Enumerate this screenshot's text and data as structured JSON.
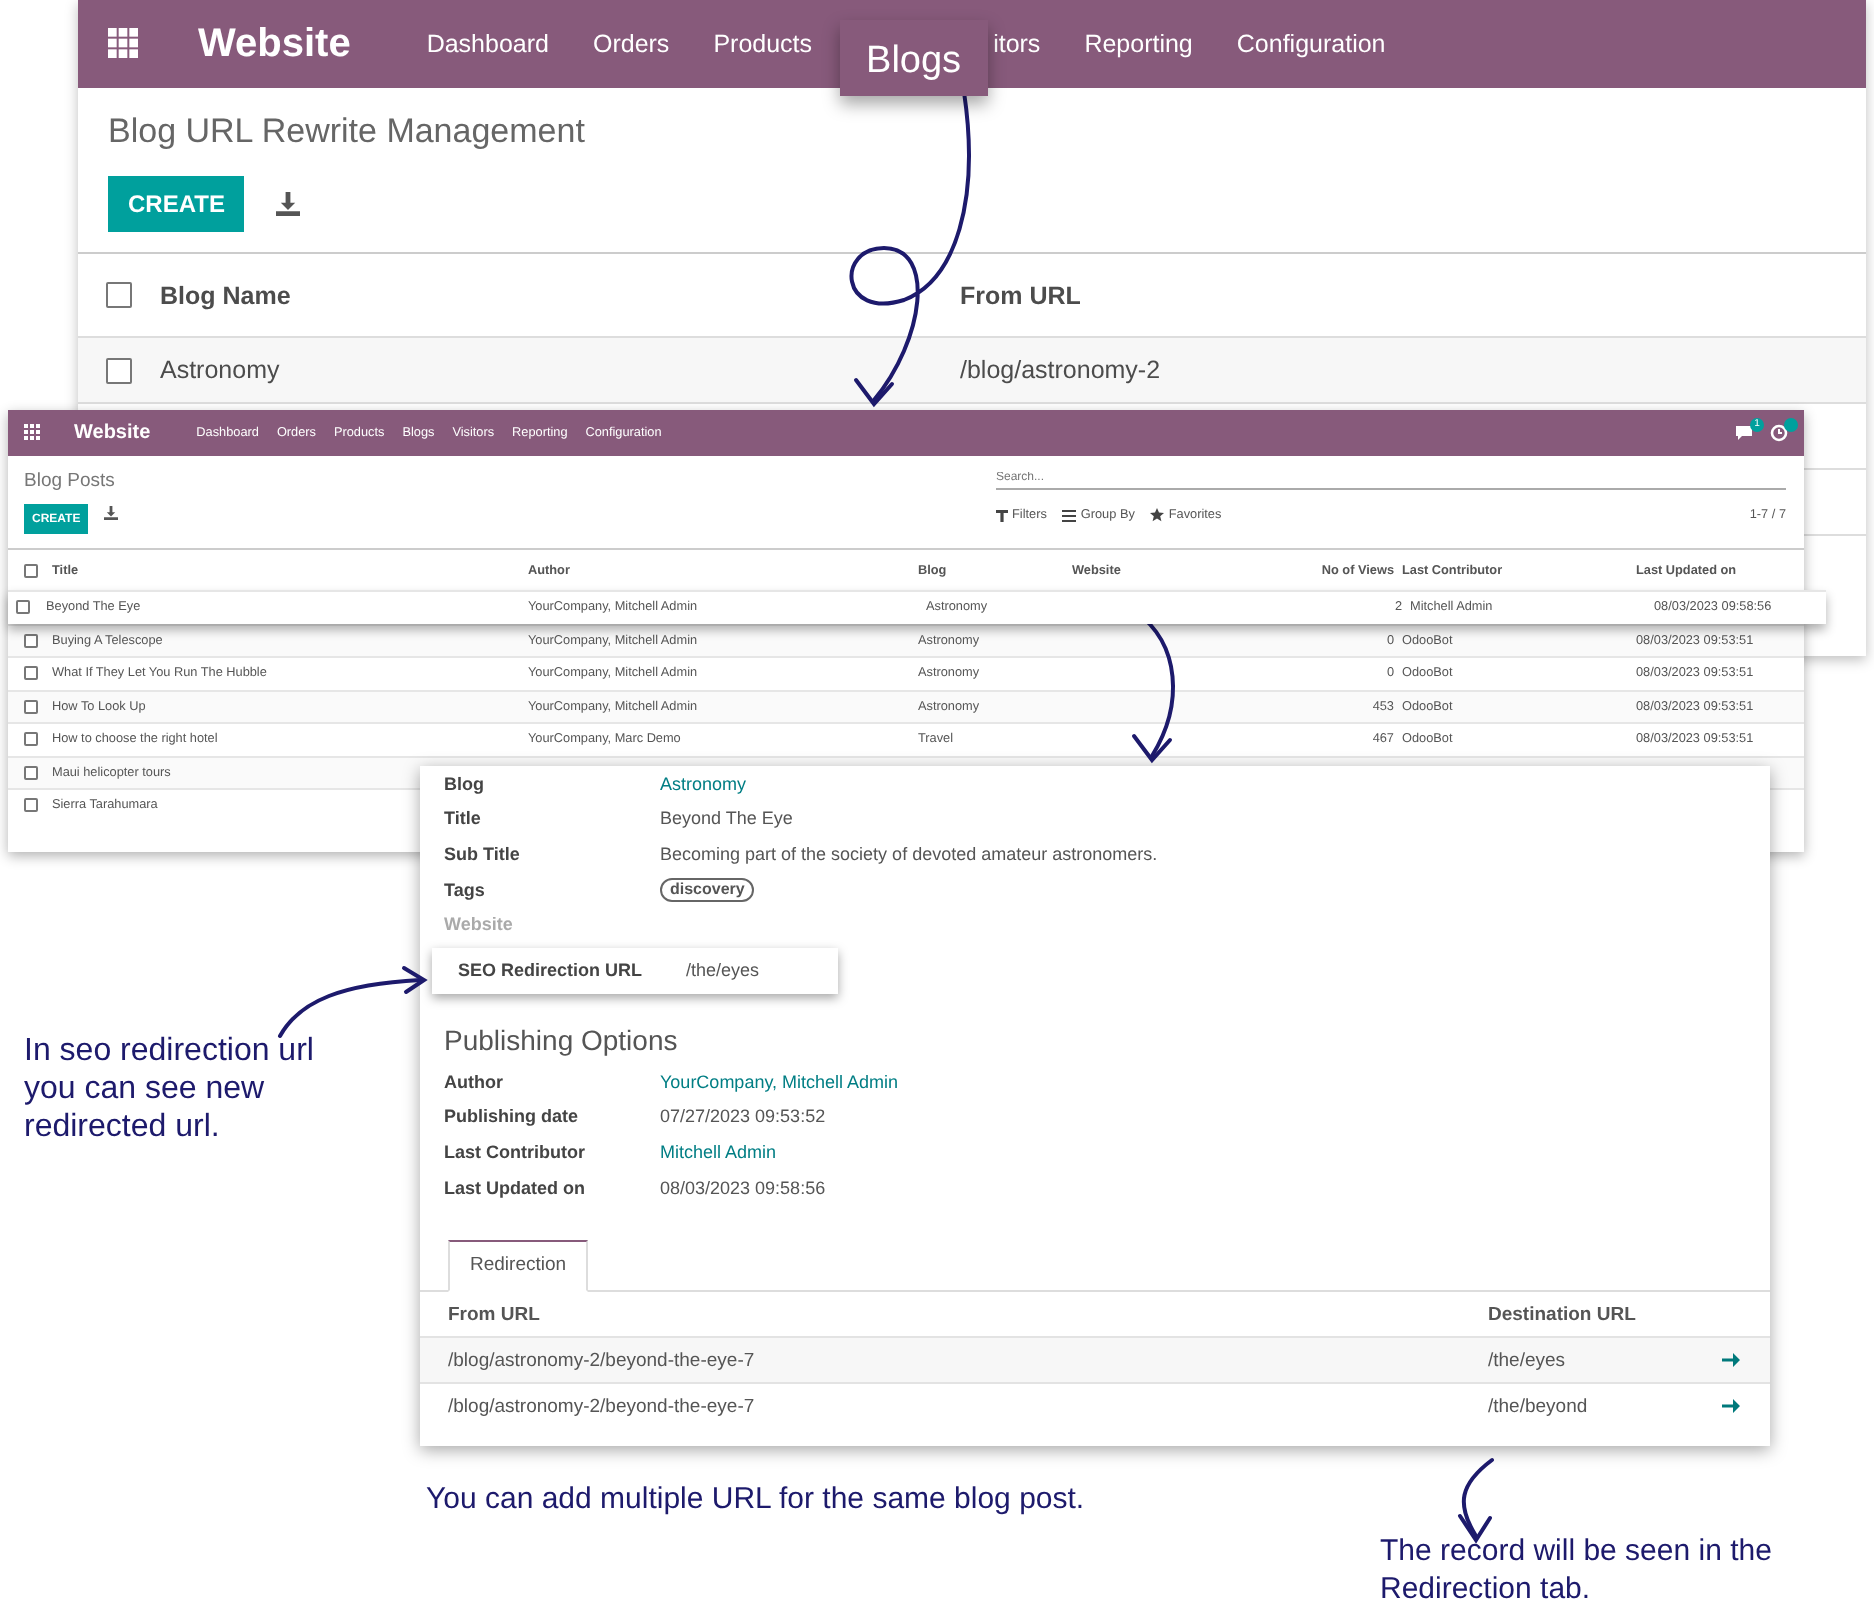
{
  "rewrite_window": {
    "app_name": "Website",
    "menu": [
      {
        "label": "Dashboard",
        "selected": false
      },
      {
        "label": "Orders",
        "selected": false
      },
      {
        "label": "Products",
        "selected": false
      },
      {
        "label": "Blogs",
        "selected": true
      },
      {
        "label": "itors",
        "selected": false
      },
      {
        "label": "Reporting",
        "selected": false
      },
      {
        "label": "Configuration",
        "selected": false
      }
    ],
    "title": "Blog URL Rewrite Management",
    "create_button": "CREATE",
    "select_all": {
      "checked": false
    },
    "columns": [
      "Blog Name",
      "From URL"
    ],
    "rows": [
      {
        "blog_name": "Astronomy",
        "from_url": "/blog/astronomy-2",
        "checked": false
      }
    ]
  },
  "posts_window": {
    "app_name": "Website",
    "menu": [
      {
        "label": "Dashboard",
        "selected": false
      },
      {
        "label": "Orders",
        "selected": false
      },
      {
        "label": "Products",
        "selected": false
      },
      {
        "label": "Blogs",
        "selected": false
      },
      {
        "label": "Visitors",
        "selected": false
      },
      {
        "label": "Reporting",
        "selected": false
      },
      {
        "label": "Configuration",
        "selected": false
      }
    ],
    "notifications": [
      {
        "kind": "chat",
        "count": "1"
      },
      {
        "kind": "activity"
      }
    ],
    "title": "Blog Posts",
    "create_button": "CREATE",
    "search": {
      "placeholder": "Search..."
    },
    "filters": [
      {
        "label": "Filters",
        "kind": "filter"
      },
      {
        "label": "Group By",
        "kind": "group"
      },
      {
        "label": "Favorites",
        "kind": "star"
      }
    ],
    "pager": "1-7 / 7",
    "select_all": {
      "checked": false
    },
    "columns": [
      "Title",
      "Author",
      "Blog",
      "Website",
      "No of Views",
      "Last Contributor",
      "Last Updated on"
    ],
    "rows": [
      {
        "title": "Beyond The Eye",
        "author": "YourCompany, Mitchell Admin",
        "blog": "Astronomy",
        "views": "2",
        "last_contributor": "Mitchell Admin",
        "last_updated": "08/03/2023 09:58:56",
        "highlighted": true,
        "checked": false
      },
      {
        "title": "Buying A Telescope",
        "author": "YourCompany, Mitchell Admin",
        "blog": "Astronomy",
        "views": "0",
        "last_contributor": "OdooBot",
        "last_updated": "08/03/2023 09:53:51",
        "highlighted": false,
        "checked": false
      },
      {
        "title": "What If They Let You Run The Hubble",
        "author": "YourCompany, Mitchell Admin",
        "blog": "Astronomy",
        "views": "0",
        "last_contributor": "OdooBot",
        "last_updated": "08/03/2023 09:53:51",
        "highlighted": false,
        "checked": false
      },
      {
        "title": "How To Look Up",
        "author": "YourCompany, Mitchell Admin",
        "blog": "Astronomy",
        "views": "453",
        "last_contributor": "OdooBot",
        "last_updated": "08/03/2023 09:53:51",
        "highlighted": false,
        "checked": false
      },
      {
        "title": "How to choose the right hotel",
        "author": "YourCompany, Marc Demo",
        "blog": "Travel",
        "views": "467",
        "last_contributor": "OdooBot",
        "last_updated": "08/03/2023 09:53:51",
        "highlighted": false,
        "checked": false
      },
      {
        "title": "Maui helicopter tours",
        "highlighted": false,
        "checked": false
      },
      {
        "title": "Sierra Tarahumara",
        "highlighted": false,
        "checked": false
      }
    ]
  },
  "detail_card": {
    "fields": [
      {
        "label": "Blog",
        "value": "Astronomy",
        "kind": "link"
      },
      {
        "label": "Title",
        "value": "Beyond The Eye",
        "kind": "text"
      },
      {
        "label": "Sub Title",
        "value": "Becoming part of the society of devoted amateur astronomers.",
        "kind": "text"
      },
      {
        "label": "Tags",
        "value": "discovery",
        "kind": "tag"
      },
      {
        "label": "Website",
        "kind": "empty"
      }
    ],
    "seo": {
      "label": "SEO Redirection URL",
      "value": "/the/eyes"
    },
    "section_title": "Publishing Options",
    "publishing": [
      {
        "label": "Author",
        "value": "YourCompany, Mitchell Admin",
        "kind": "link"
      },
      {
        "label": "Publishing date",
        "value": "07/27/2023 09:53:52",
        "kind": "text"
      },
      {
        "label": "Last Contributor",
        "value": "Mitchell Admin",
        "kind": "link"
      },
      {
        "label": "Last Updated on",
        "value": "08/03/2023 09:58:56",
        "kind": "text"
      }
    ],
    "tabs": [
      {
        "label": "Redirection",
        "selected": true
      }
    ],
    "redirect_columns": [
      "From URL",
      "Destination URL"
    ],
    "redirects": [
      {
        "from_url": "/blog/astronomy-2/beyond-the-eye-7",
        "destination_url": "/the/eyes"
      },
      {
        "from_url": "/blog/astronomy-2/beyond-the-eye-7",
        "destination_url": "/the/beyond"
      }
    ]
  },
  "notes": [
    {
      "text": "In seo redirection url you can see new redirected url.",
      "kind": "left"
    },
    {
      "text": "You can add multiple URL for the same blog post.",
      "kind": "bottom"
    },
    {
      "text": "The record will be seen in the Redirection tab.",
      "kind": "corner"
    }
  ]
}
